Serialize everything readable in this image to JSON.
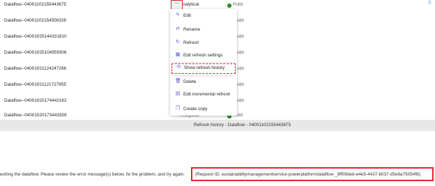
{
  "rows": [
    {
      "name": "Dataflow--04001102155443675",
      "type": "Analytical",
      "status": "Publi"
    },
    {
      "name": "Dataflow--04001102154556328",
      "type": "",
      "status": "ubli"
    },
    {
      "name": "Dataflow--04001025144331810",
      "type": "",
      "status": "ubli"
    },
    {
      "name": "Dataflow--04001025104959306",
      "type": "",
      "status": "ubli"
    },
    {
      "name": "Dataflow--04001021124247266",
      "type": "",
      "status": "ubli"
    },
    {
      "name": "Dataflow--04001021121727955",
      "type": "",
      "status": "ubli"
    },
    {
      "name": "Dataflow--04001020174442162",
      "type": "",
      "status": "ubli"
    },
    {
      "name": "Dataflow--04001020173443359",
      "type": "Analytical",
      "status": "Publi"
    }
  ],
  "more_button": "···",
  "menu": {
    "edit": "Edit",
    "rename": "Rename",
    "refresh": "Refresh",
    "edit_refresh_settings": "Edit refresh settings",
    "show_refresh_history": "Show refresh history",
    "delete": "Delete",
    "edit_incremental_refresh": "Edit incremental refresh",
    "create_copy": "Create copy"
  },
  "icons": {
    "edit": "pencil-icon",
    "rename": "rename-icon",
    "refresh": "refresh-icon",
    "settings": "calendar-settings-icon",
    "history": "history-icon",
    "delete": "trash-icon",
    "incremental": "incremental-refresh-icon",
    "copy": "copy-icon",
    "status": "checkmark-circle-icon"
  },
  "history_title": "Refresh history - Dataflow - 04001102155443675",
  "error_message": "eshing the dataflow. Please review the error message(s) below, fix the problem, and try again.",
  "request_id": "(Request ID: sustainabilitymanagementservice-powerplatformdataflow-_8ff09deb-e4e5-4437-b037-d5e8a75054f8).",
  "colors": {
    "highlight": "#e3222b",
    "icon": "#5b57c6",
    "success": "#107c10"
  }
}
